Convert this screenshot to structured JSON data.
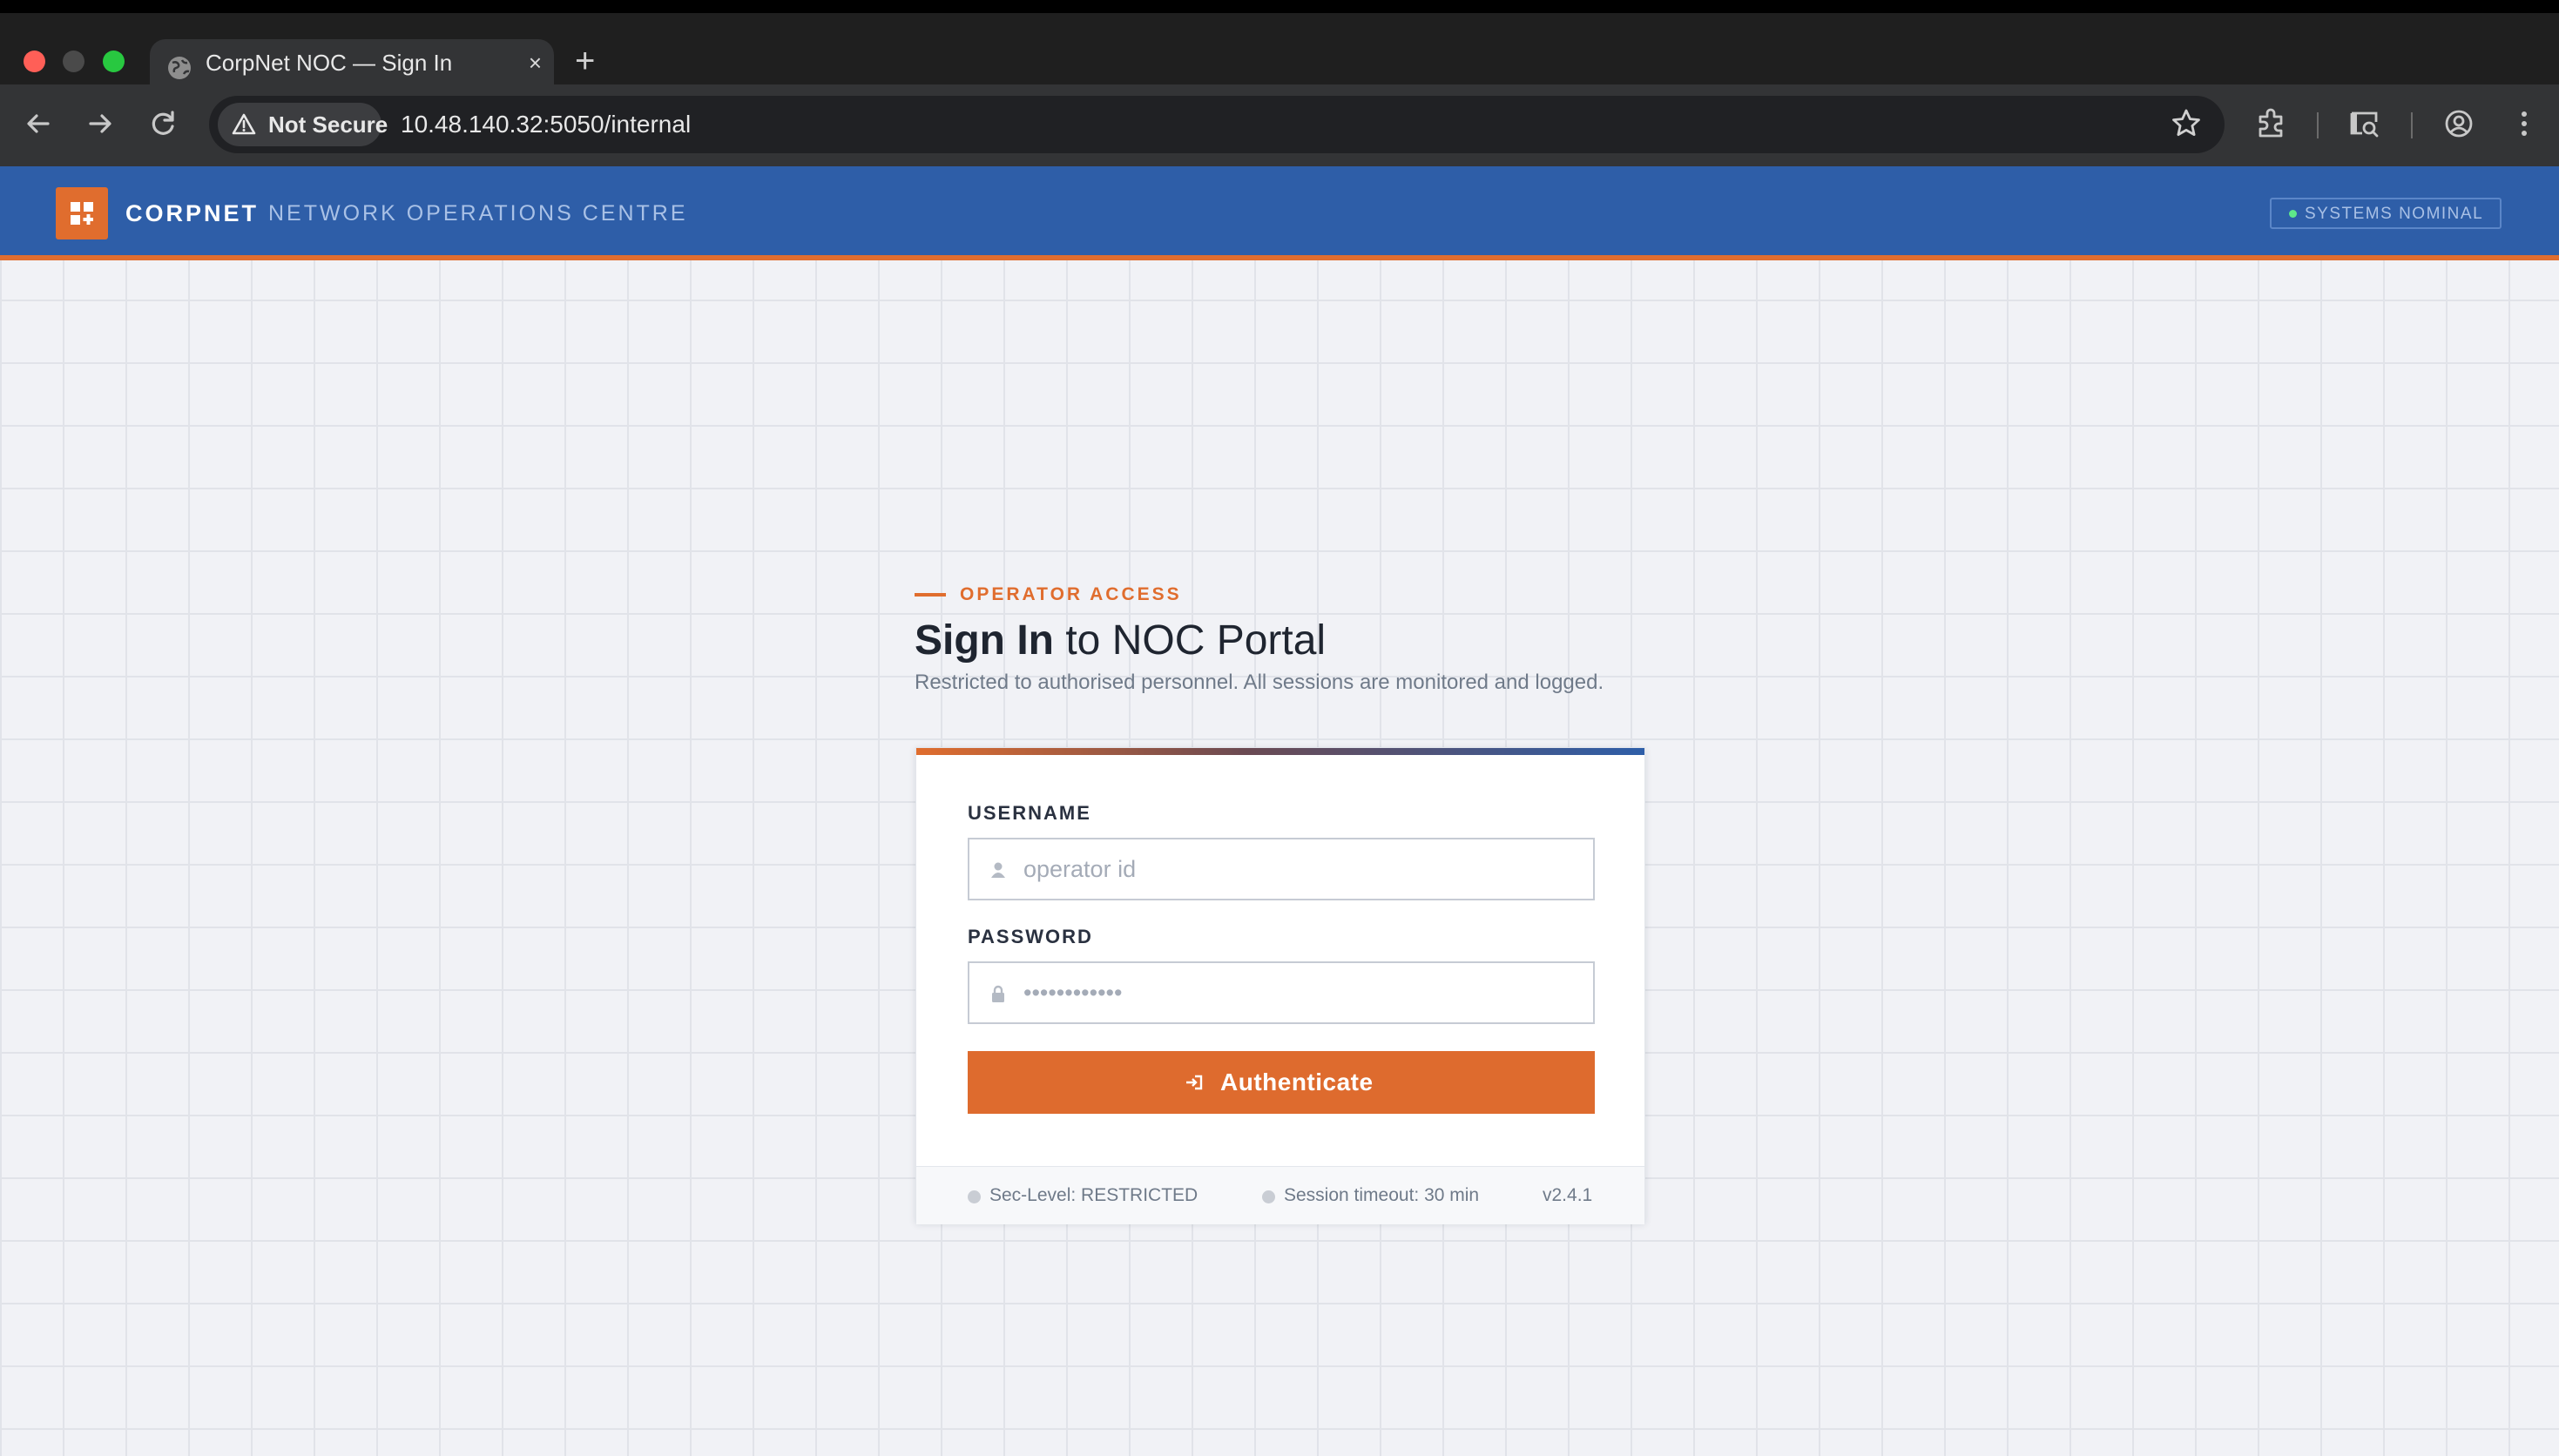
{
  "browser": {
    "tab_title": "CorpNet NOC — Sign In",
    "tab_close": "×",
    "new_tab": "+",
    "security_label": "Not Secure",
    "url": "10.48.140.32:5050/internal"
  },
  "header": {
    "brand": "CORPNET",
    "subtitle": "NETWORK OPERATIONS CENTRE",
    "status": "SYSTEMS NOMINAL",
    "status_color": "#5ee88a",
    "brand_color": "#2e5ea8",
    "accent_color": "#e06d2e"
  },
  "login": {
    "eyebrow": "OPERATOR ACCESS",
    "title_strong": "Sign In",
    "title_rest": " to NOC Portal",
    "subtitle": "Restricted to authorised personnel. All sessions are monitored and logged.",
    "username_label": "USERNAME",
    "username_placeholder": "operator id",
    "password_label": "PASSWORD",
    "password_placeholder": "••••••••••••",
    "button_label": "Authenticate",
    "icons": [
      "user-icon",
      "lock-icon",
      "login-icon"
    ]
  },
  "footer": {
    "sec_level": "Sec-Level: RESTRICTED",
    "session_timeout": "Session timeout: 30 min",
    "version": "v2.4.1"
  }
}
